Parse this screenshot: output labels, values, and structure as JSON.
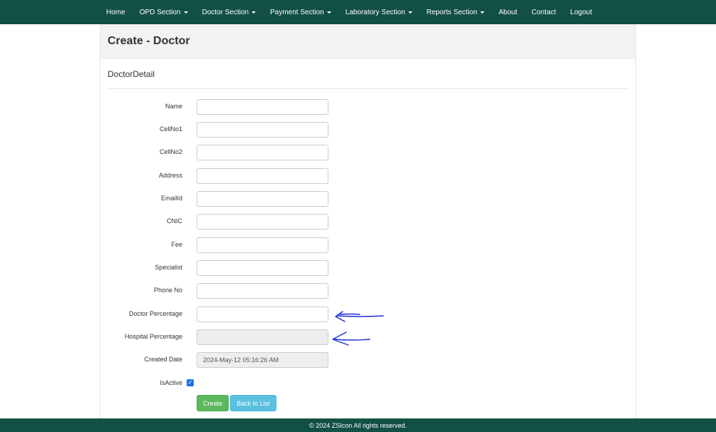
{
  "nav": {
    "items": [
      {
        "label": "Home",
        "dropdown": false
      },
      {
        "label": "OPD Section",
        "dropdown": true
      },
      {
        "label": "Doctor Section",
        "dropdown": true
      },
      {
        "label": "Payment Section",
        "dropdown": true
      },
      {
        "label": "Laboratory Section",
        "dropdown": true
      },
      {
        "label": "Reports Section",
        "dropdown": true
      },
      {
        "label": "About",
        "dropdown": false
      },
      {
        "label": "Contact",
        "dropdown": false
      },
      {
        "label": "Logout",
        "dropdown": false
      }
    ]
  },
  "page": {
    "title": "Create - Doctor",
    "section_title": "DoctorDetail"
  },
  "form": {
    "fields": [
      {
        "label": "Name",
        "value": "",
        "disabled": false
      },
      {
        "label": "CellNo1",
        "value": "",
        "disabled": false
      },
      {
        "label": "CellNo2",
        "value": "",
        "disabled": false
      },
      {
        "label": "Address",
        "value": "",
        "disabled": false
      },
      {
        "label": "EmailId",
        "value": "",
        "disabled": false
      },
      {
        "label": "CNIC",
        "value": "",
        "disabled": false
      },
      {
        "label": "Fee",
        "value": "",
        "disabled": false
      },
      {
        "label": "Specialist",
        "value": "",
        "disabled": false
      },
      {
        "label": "Phone No",
        "value": "",
        "disabled": false
      },
      {
        "label": "Doctor Percentage",
        "value": "",
        "disabled": false
      },
      {
        "label": "Hospital Percentage",
        "value": "",
        "disabled": true
      },
      {
        "label": "Created Date",
        "value": "2024-May-12 05:16:26 AM",
        "disabled": true
      }
    ],
    "isactive": {
      "label": "IsActive",
      "checked": true
    },
    "create_label": "Create",
    "back_label": "Back to List"
  },
  "footer": {
    "text": "© 2024 ZSIcon All rights reserved."
  },
  "colors": {
    "navbar": "#124f45",
    "create_button": "#5cb85c",
    "back_button": "#5bc0de",
    "annotation_arrow": "#1a2fd4"
  }
}
